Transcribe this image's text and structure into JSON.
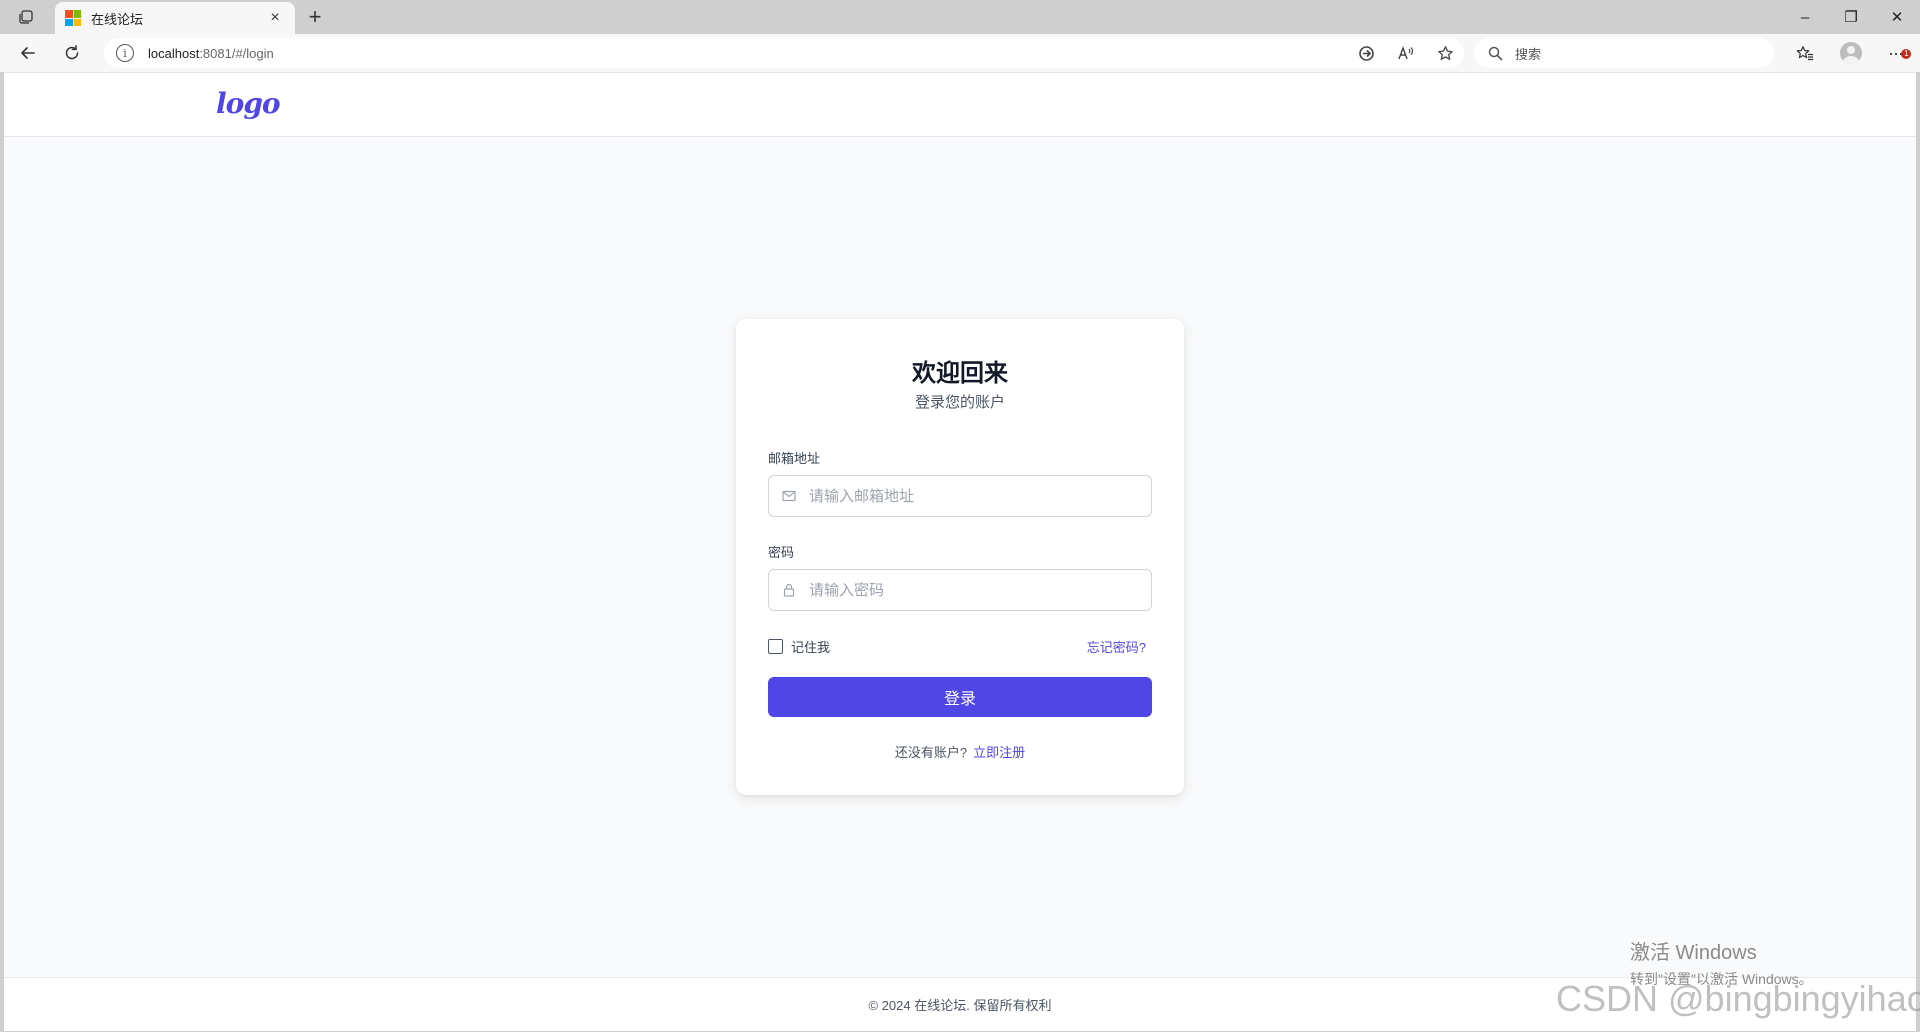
{
  "browser": {
    "tab_title": "在线论坛",
    "tab_close": "×",
    "new_tab": "+",
    "url_host": "localhost",
    "url_rest": ":8081/#/login",
    "search_placeholder": "搜索",
    "win_minimize": "–",
    "win_restore": "❐",
    "win_close": "✕",
    "more_badge": "1"
  },
  "header": {
    "logo": "logo"
  },
  "login": {
    "title": "欢迎回来",
    "subtitle": "登录您的账户",
    "email_label": "邮箱地址",
    "email_placeholder": "请输入邮箱地址",
    "password_label": "密码",
    "password_placeholder": "请输入密码",
    "remember_label": "记住我",
    "forgot_link": "忘记密码?",
    "submit_label": "登录",
    "no_account_text": "还没有账户?",
    "register_link": "立即注册"
  },
  "footer": {
    "copyright": "© 2024 在线论坛. 保留所有权利"
  },
  "overlay": {
    "activate_title": "激活 Windows",
    "activate_sub": "转到\"设置\"以激活 Windows。",
    "watermark": "CSDN @bingbingyihao"
  },
  "colors": {
    "accent": "#4f46e5",
    "page_bg": "#f9fafb",
    "card_bg": "#ffffff"
  },
  "icons": {
    "email_field": "mail-icon",
    "password_field": "lock-icon"
  }
}
